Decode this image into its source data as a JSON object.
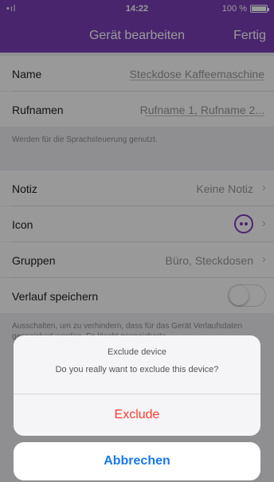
{
  "status": {
    "signal": "•ıl",
    "time": "14:22",
    "battery": "100 %"
  },
  "nav": {
    "title": "Gerät bearbeiten",
    "done": "Fertig"
  },
  "rows": {
    "name_label": "Name",
    "name_value": "Steckdose Kaffeemaschine",
    "rufnamen_label": "Rufnamen",
    "rufnamen_placeholder": "Rufname 1, Rufname 2...",
    "rufnamen_hint": "Werden für die Sprachsteuerung genutzt.",
    "notiz_label": "Notiz",
    "notiz_value": "Keine Notiz",
    "icon_label": "Icon",
    "gruppen_label": "Gruppen",
    "gruppen_value": "Büro, Steckdosen",
    "verlauf_label": "Verlauf speichern",
    "verlauf_hint": "Ausschalten, um zu verhindern, dass für das Gerät Verlaufsdaten gespeichert werden. Es löscht gespeicherte"
  },
  "toggle": {
    "verlauf_on": false
  },
  "sheet": {
    "title": "Exclude device",
    "message": "Do you really want to exclude this device?",
    "exclude": "Exclude",
    "cancel": "Abbrechen"
  },
  "colors": {
    "accent": "#7b3fb8",
    "destructive": "#ff3b30",
    "link": "#1c78e8"
  }
}
